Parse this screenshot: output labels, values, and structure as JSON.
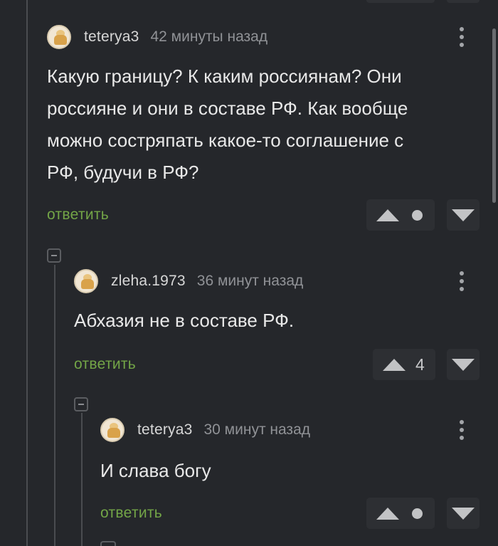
{
  "comments": [
    {
      "username": "teterya3",
      "timestamp": "42 минуты назад",
      "text_lines": [
        "Какую границу? К каким россиянам? Они",
        "россияне и они в составе РФ. Как вообще",
        "можно состряпать какое-то соглашение с",
        "РФ, будучи в РФ?"
      ],
      "reply_label": "ответить",
      "score": ""
    },
    {
      "username": "zleha.1973",
      "timestamp": "36 минут назад",
      "text_lines": [
        "Абхазия не в составе РФ."
      ],
      "reply_label": "ответить",
      "score": "4"
    },
    {
      "username": "teterya3",
      "timestamp": "30 минут назад",
      "text_lines": [
        "И слава богу"
      ],
      "reply_label": "ответить",
      "score": ""
    }
  ],
  "icons": {
    "upvote": "arrow-up-icon",
    "downvote": "arrow-down-icon",
    "neutral_score": "dot-icon",
    "more": "more-vertical-icon",
    "collapse": "collapse-minus-icon",
    "avatar": "user-avatar"
  },
  "colors": {
    "background": "#25272b",
    "reply_link": "#73a547",
    "text": "#e8e8e8",
    "meta": "#909296",
    "button_bg": "#2d2f33"
  }
}
